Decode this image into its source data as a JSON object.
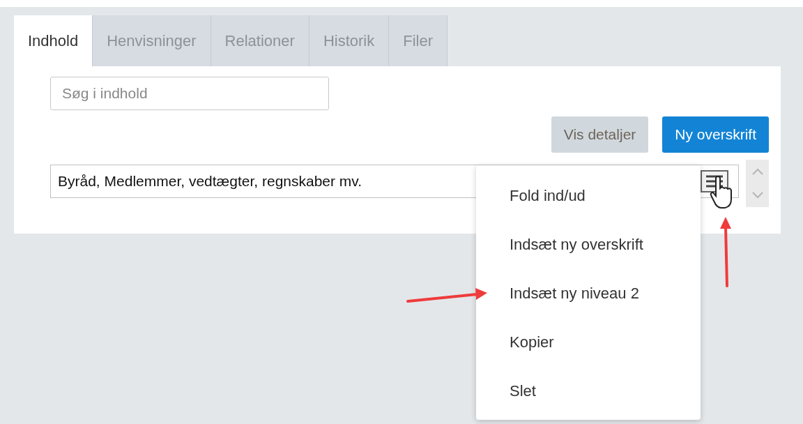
{
  "tabs": [
    {
      "label": "Indhold",
      "selected": true
    },
    {
      "label": "Henvisninger",
      "selected": false
    },
    {
      "label": "Relationer",
      "selected": false
    },
    {
      "label": "Historik",
      "selected": false
    },
    {
      "label": "Filer",
      "selected": false
    }
  ],
  "search": {
    "placeholder": "Søg i indhold"
  },
  "buttons": [
    {
      "label": "Vis detaljer",
      "kind": "secondary"
    },
    {
      "label": "Ny overskrift",
      "kind": "primary"
    }
  ],
  "heading_row": {
    "value": "Byråd, Medlemmer, vedtægter, regnskaber mv."
  },
  "context_menu": {
    "items": [
      {
        "label": "Fold ind/ud"
      },
      {
        "label": "Indsæt ny overskrift"
      },
      {
        "label": "Indsæt ny niveau 2"
      },
      {
        "label": "Kopier"
      },
      {
        "label": "Slet"
      }
    ]
  }
}
